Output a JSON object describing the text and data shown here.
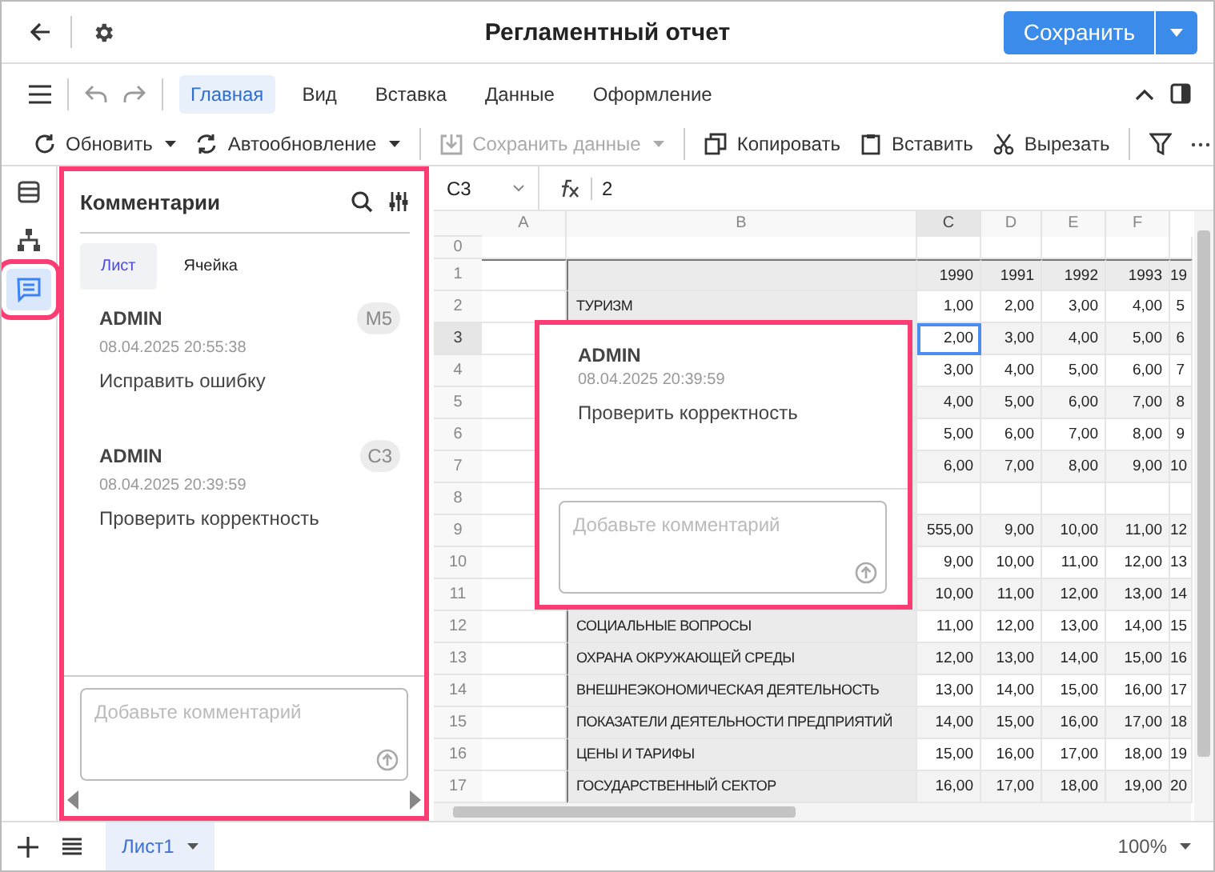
{
  "header": {
    "title": "Регламентный отчет",
    "save_button": "Сохранить"
  },
  "menu_tabs": [
    {
      "label": "Главная",
      "selected": true
    },
    {
      "label": "Вид",
      "selected": false
    },
    {
      "label": "Вставка",
      "selected": false
    },
    {
      "label": "Данные",
      "selected": false
    },
    {
      "label": "Оформление",
      "selected": false
    }
  ],
  "toolbar": [
    {
      "kind": "refresh",
      "label": "Обновить",
      "dropdown": true,
      "disabled": false
    },
    {
      "kind": "autorefresh",
      "label": "Автообновление",
      "dropdown": true,
      "disabled": false
    },
    {
      "kind": "save-data",
      "label": "Сохранить данные",
      "dropdown": true,
      "disabled": true
    },
    {
      "kind": "copy",
      "label": "Копировать",
      "dropdown": false,
      "disabled": false
    },
    {
      "kind": "paste",
      "label": "Вставить",
      "dropdown": false,
      "disabled": false
    },
    {
      "kind": "cut",
      "label": "Вырезать",
      "dropdown": false,
      "disabled": false
    }
  ],
  "rail": [
    {
      "kind": "layers",
      "selected": false
    },
    {
      "kind": "tree",
      "selected": false
    },
    {
      "kind": "comments",
      "selected": true
    }
  ],
  "comments_panel": {
    "title": "Комментарии",
    "tabs": [
      {
        "label": "Лист",
        "selected": true
      },
      {
        "label": "Ячейка",
        "selected": false
      }
    ],
    "comments": [
      {
        "author": "ADMIN",
        "date": "08.04.2025 20:55:38",
        "text": "Исправить ошибку",
        "cell": "M5"
      },
      {
        "author": "ADMIN",
        "date": "08.04.2025 20:39:59",
        "text": "Проверить корректность",
        "cell": "C3"
      }
    ],
    "input": {
      "placeholder": "Добавьте комментарий"
    }
  },
  "sheet": {
    "name_box": "C3",
    "formula": "2",
    "columns": [
      {
        "label": "A",
        "selected": false
      },
      {
        "label": "B",
        "selected": false
      },
      {
        "label": "C",
        "selected": true
      },
      {
        "label": "D",
        "selected": false
      },
      {
        "label": "E",
        "selected": false
      },
      {
        "label": "F",
        "selected": false
      }
    ],
    "rows": [
      {
        "number": "0",
        "selected": false
      },
      {
        "number": "1",
        "selected": false,
        "values": [
          "1990",
          "1991",
          "1992",
          "1993",
          "19"
        ]
      },
      {
        "number": "2",
        "selected": false,
        "label": "ТУРИЗМ",
        "values": [
          "1,00",
          "2,00",
          "3,00",
          "4,00",
          "5"
        ]
      },
      {
        "number": "3",
        "selected": true,
        "values": [
          "2,00",
          "3,00",
          "4,00",
          "5,00",
          "6"
        ]
      },
      {
        "number": "4",
        "selected": false,
        "values": [
          "3,00",
          "4,00",
          "5,00",
          "6,00",
          "7"
        ]
      },
      {
        "number": "5",
        "selected": false,
        "values": [
          "4,00",
          "5,00",
          "6,00",
          "7,00",
          "8"
        ]
      },
      {
        "number": "6",
        "selected": false,
        "values": [
          "5,00",
          "6,00",
          "7,00",
          "8,00",
          "9"
        ]
      },
      {
        "number": "7",
        "selected": false,
        "values": [
          "6,00",
          "7,00",
          "8,00",
          "9,00",
          "10"
        ]
      },
      {
        "number": "8",
        "selected": false
      },
      {
        "number": "9",
        "selected": false,
        "values": [
          "555,00",
          "9,00",
          "10,00",
          "11,00",
          "12"
        ]
      },
      {
        "number": "10",
        "selected": false,
        "values": [
          "9,00",
          "10,00",
          "11,00",
          "12,00",
          "13"
        ]
      },
      {
        "number": "11",
        "selected": false,
        "values": [
          "10,00",
          "11,00",
          "12,00",
          "13,00",
          "14"
        ]
      },
      {
        "number": "12",
        "selected": false,
        "label": "СОЦИАЛЬНЫЕ ВОПРОСЫ",
        "values": [
          "11,00",
          "12,00",
          "13,00",
          "14,00",
          "15"
        ]
      },
      {
        "number": "13",
        "selected": false,
        "label": "ОХРАНА ОКРУЖАЮЩЕЙ СРЕДЫ",
        "values": [
          "12,00",
          "13,00",
          "14,00",
          "15,00",
          "16"
        ]
      },
      {
        "number": "14",
        "selected": false,
        "label": "ВНЕШНЕЭКОНОМИЧЕСКАЯ ДЕЯТЕЛЬНОСТЬ",
        "values": [
          "13,00",
          "14,00",
          "15,00",
          "16,00",
          "17"
        ]
      },
      {
        "number": "15",
        "selected": false,
        "label": "ПОКАЗАТЕЛИ ДЕЯТЕЛЬНОСТИ ПРЕДПРИЯТИЙ",
        "values": [
          "14,00",
          "15,00",
          "16,00",
          "17,00",
          "18"
        ]
      },
      {
        "number": "16",
        "selected": false,
        "label": "ЦЕНЫ И ТАРИФЫ",
        "values": [
          "15,00",
          "16,00",
          "17,00",
          "18,00",
          "19"
        ]
      },
      {
        "number": "17",
        "selected": false,
        "label": "ГОСУДАРСТВЕННЫЙ СЕКТОР",
        "values": [
          "16,00",
          "17,00",
          "18,00",
          "19,00",
          "20"
        ]
      }
    ],
    "popup": {
      "author": "ADMIN",
      "date": "08.04.2025 20:39:59",
      "text": "Проверить корректность",
      "placeholder": "Добавьте комментарий"
    }
  },
  "footer": {
    "sheets": [
      {
        "label": "Лист1",
        "selected": true
      }
    ],
    "zoom": "100%"
  }
}
